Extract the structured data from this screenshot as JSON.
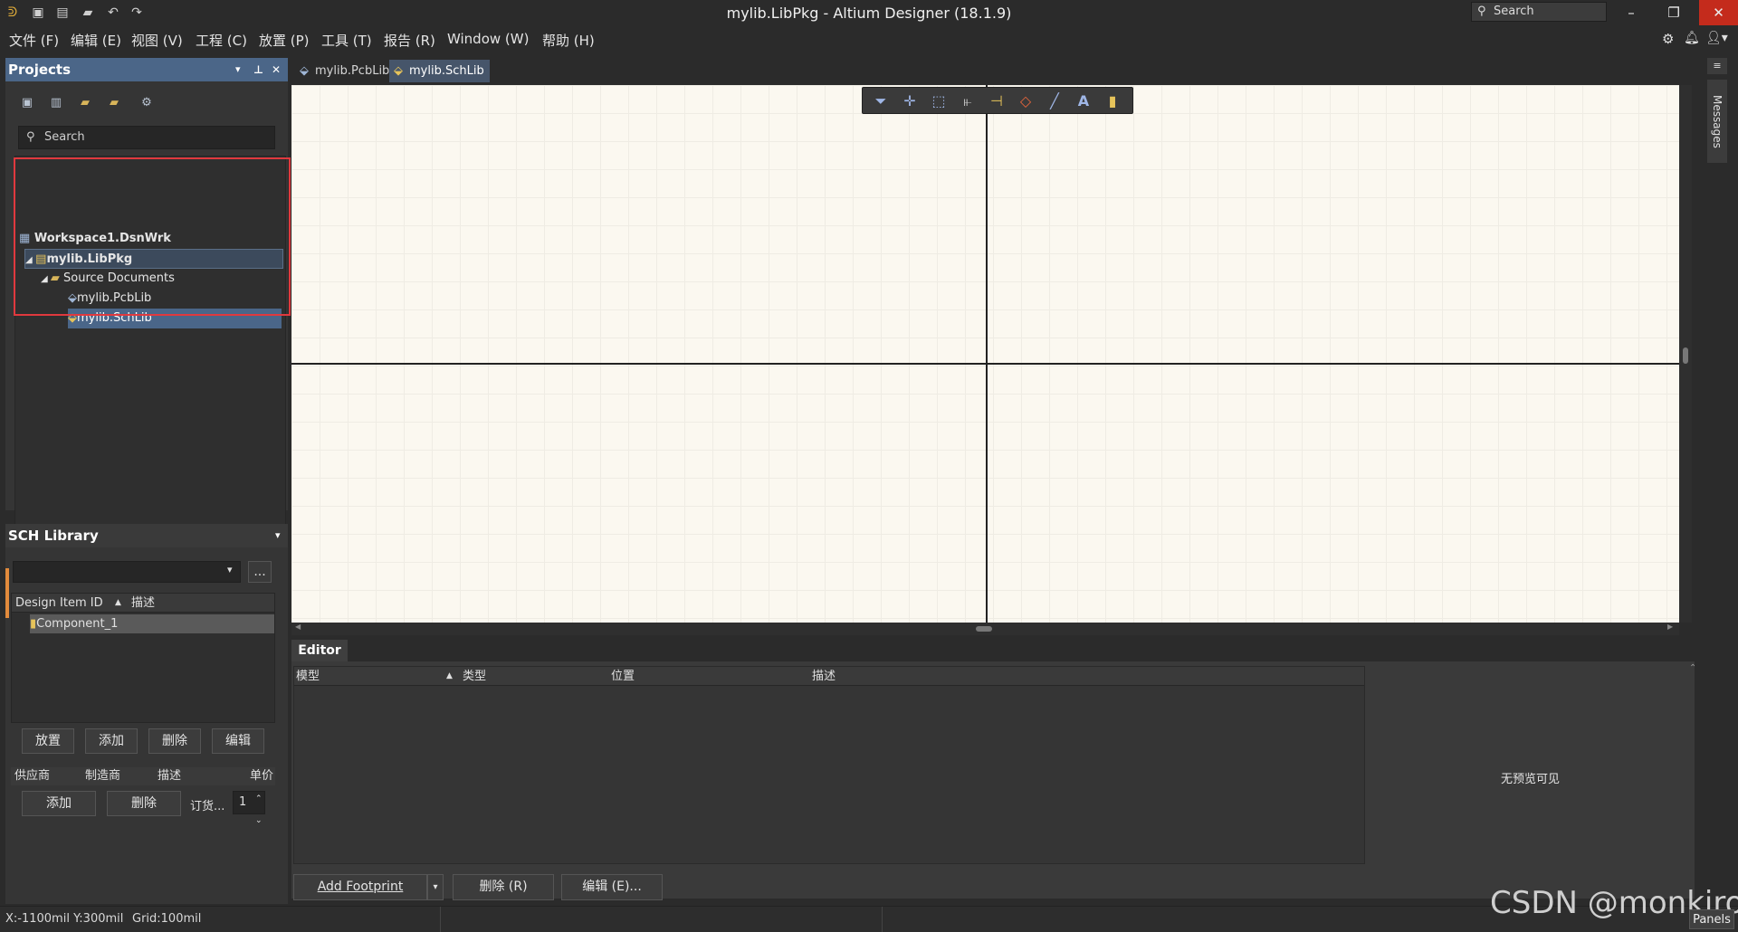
{
  "window": {
    "title": "mylib.LibPkg - Altium Designer (18.1.9)",
    "search_placeholder": "Search"
  },
  "menu": [
    {
      "label": "文件 (F)"
    },
    {
      "label": "编辑 (E)"
    },
    {
      "label": "视图 (V)"
    },
    {
      "label": "工程 (C)"
    },
    {
      "label": "放置 (P)"
    },
    {
      "label": "工具 (T)"
    },
    {
      "label": "报告 (R)"
    },
    {
      "label": "Window (W)"
    },
    {
      "label": "帮助 (H)"
    }
  ],
  "projects": {
    "title": "Projects",
    "search_placeholder": "Search",
    "tree": {
      "workspace": "Workspace1.DsnWrk",
      "project": "mylib.LibPkg",
      "folder": "Source Documents",
      "doc1": "mylib.PcbLib",
      "doc2": "mylib.SchLib"
    }
  },
  "schlib": {
    "title": "SCH Library",
    "browse_label": "...",
    "col_id": "Design Item ID",
    "col_desc": "描述",
    "row1": "Component_1",
    "btn_place": "放置",
    "btn_add": "添加",
    "btn_delete": "删除",
    "btn_edit": "编辑",
    "sup_col1": "供应商",
    "sup_col2": "制造商",
    "sup_col3": "描述",
    "sup_col4": "单价",
    "sup_add": "添加",
    "sup_delete": "删除",
    "order_label": "订货...",
    "order_qty": "1"
  },
  "tabs": [
    {
      "label": "mylib.PcbLib"
    },
    {
      "label": "mylib.SchLib"
    }
  ],
  "editor": {
    "tab": "Editor",
    "col_model": "模型",
    "col_type": "类型",
    "col_pos": "位置",
    "col_desc": "描述",
    "no_preview": "无预览可见",
    "btn_add_footprint": "Add Footprint",
    "btn_delete": "删除 (R)",
    "btn_edit": "编辑 (E)..."
  },
  "rightrail": {
    "messages": "Messages",
    "panels": "Panels"
  },
  "status": {
    "coords": "X:-1100mil Y:300mil",
    "grid": "Grid:100mil"
  },
  "watermark": "CSDN @monkiro"
}
